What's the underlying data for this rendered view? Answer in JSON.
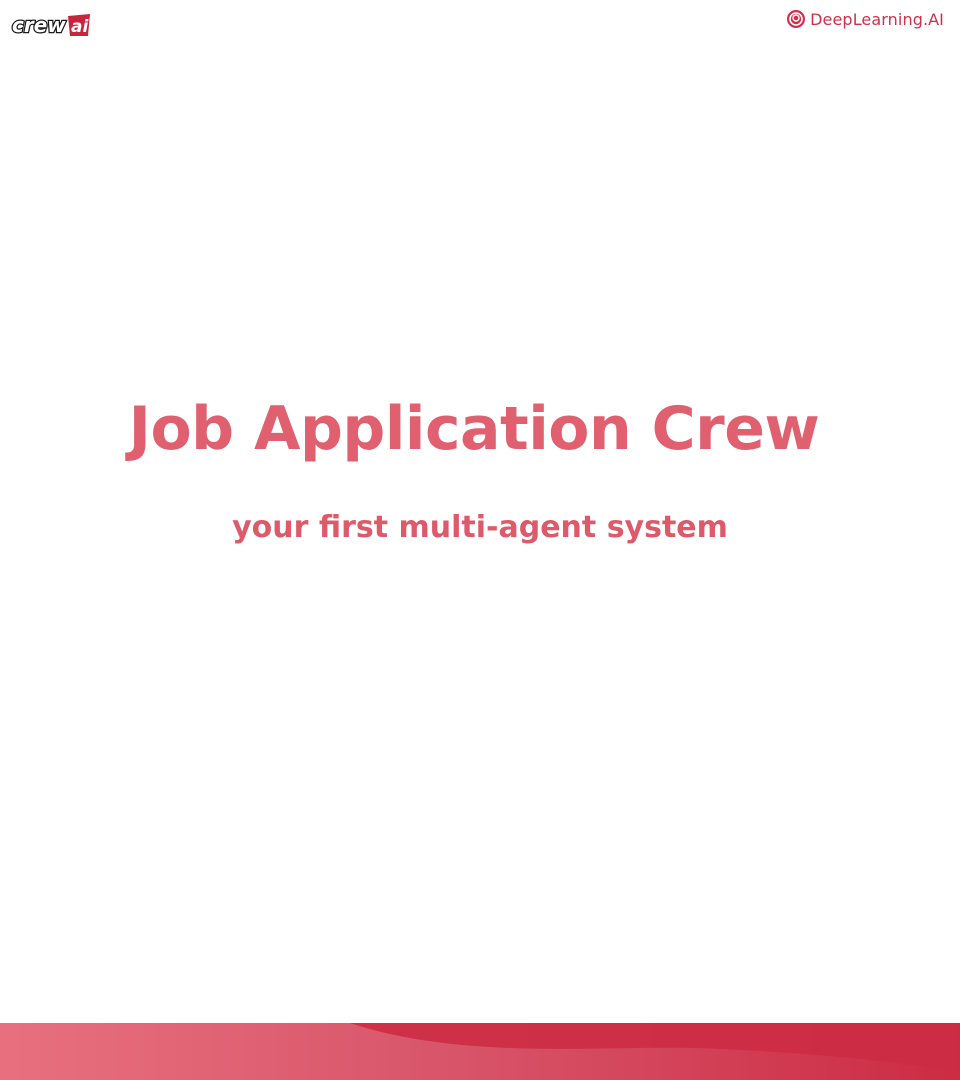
{
  "header": {
    "left_logo": {
      "text": "crewai",
      "icon": "crewai-logo"
    },
    "right_logo": {
      "text": "DeepLearning.AI",
      "icon": "deeplearning-ai-logo-icon"
    }
  },
  "main": {
    "title": "Job Application Crew",
    "subtitle": "your first multi-agent system"
  },
  "theme": {
    "accent": "#e0606f",
    "brand_red": "#d0304a",
    "wave_light": "#e8707e",
    "wave_dark": "#cc2c44",
    "background": "#ffffff"
  }
}
